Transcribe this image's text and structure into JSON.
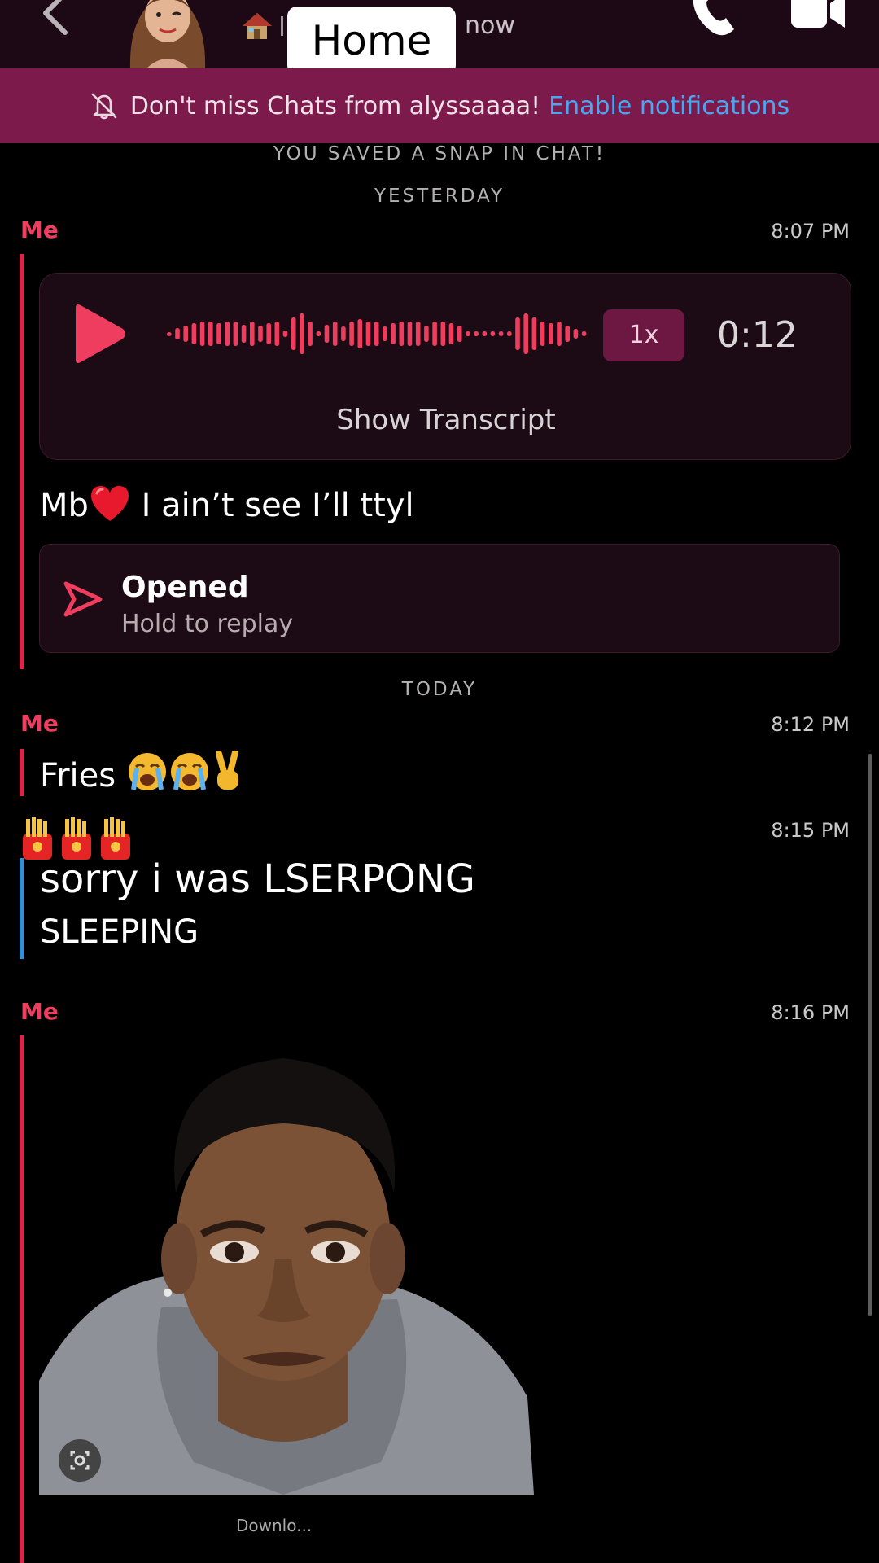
{
  "header": {
    "pill_label": "Home",
    "last_seen": "now"
  },
  "banner": {
    "text": "Don't miss Chats from alyssaaaa!",
    "link": "Enable notifications"
  },
  "chat": {
    "saved_notice": "YOU SAVED A SNAP IN CHAT!",
    "day_yesterday": "YESTERDAY",
    "day_today": "TODAY",
    "me_label": "Me",
    "times": [
      "8:07 PM",
      "8:12 PM",
      "8:15 PM",
      "8:16 PM"
    ],
    "voice_note": {
      "speed": "1x",
      "duration": "0:12",
      "transcript_label": "Show Transcript"
    },
    "message_mb_start": "Mb",
    "message_mb_end": " I ain’t see I’ll ttyl",
    "opened_snap": {
      "title": "Opened",
      "subtitle": "Hold to replay"
    },
    "message_fries": "Fries",
    "reply_line1": "sorry i was LSERPONG",
    "reply_line2": "SLEEPING",
    "photo_caption": "Downlo..."
  },
  "colors": {
    "topbar": "#1d0915",
    "banner": "#7b1a4b",
    "accent_red": "#ee3d5e",
    "accent_blue": "#3fa9e8",
    "link_blue": "#49a7f2"
  }
}
